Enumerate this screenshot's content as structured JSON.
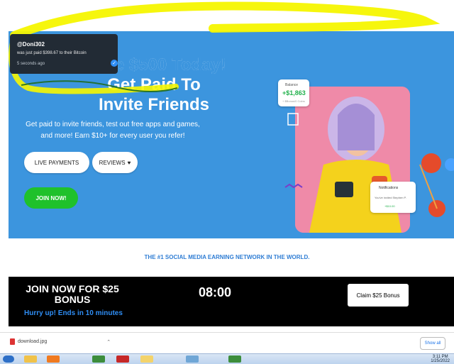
{
  "toast": {
    "username": "@Doni302",
    "message": "was just paid $398.67 to their Bitcoin",
    "time": "5 seconds ago"
  },
  "hero": {
    "title_line1": "Make $500 Today!",
    "title_line2": "Get Paid To",
    "title_line3": "Invite Friends",
    "subtitle": "Get paid to invite friends, test out free apps and games, and more! Earn $10+ for every user you refer!",
    "btn_live_payments": "LIVE PAYMENTS",
    "btn_reviews": "REVIEWS",
    "btn_join": "JOIN NOW!"
  },
  "balance_card": {
    "label": "Balance",
    "amount": "+$1,863",
    "subline": "+ $Bonus/0 Coins"
  },
  "notif_card": {
    "title": "Notifications",
    "line": "You've invited Stephen P.",
    "amount": "+$10.00"
  },
  "promo": {
    "text": "THE #1 SOCIAL MEDIA EARNING NETWORK IN THE WORLD."
  },
  "banner": {
    "join_text": "JOIN NOW FOR $25 BONUS",
    "hurry_text": "Hurry up! Ends in 10 minutes",
    "timer": "08:00",
    "claim_label": "Claim $25 Bonus"
  },
  "download_bar": {
    "filename": "download.jpg",
    "show_all": "Show all"
  },
  "taskbar": {
    "time": "3:11 PM",
    "date": "1/25/2022"
  },
  "colors": {
    "hero_bg": "#3c95de",
    "join_green": "#1fc12b",
    "promo_blue": "#2f7dd4",
    "banner_bg": "#000000"
  }
}
